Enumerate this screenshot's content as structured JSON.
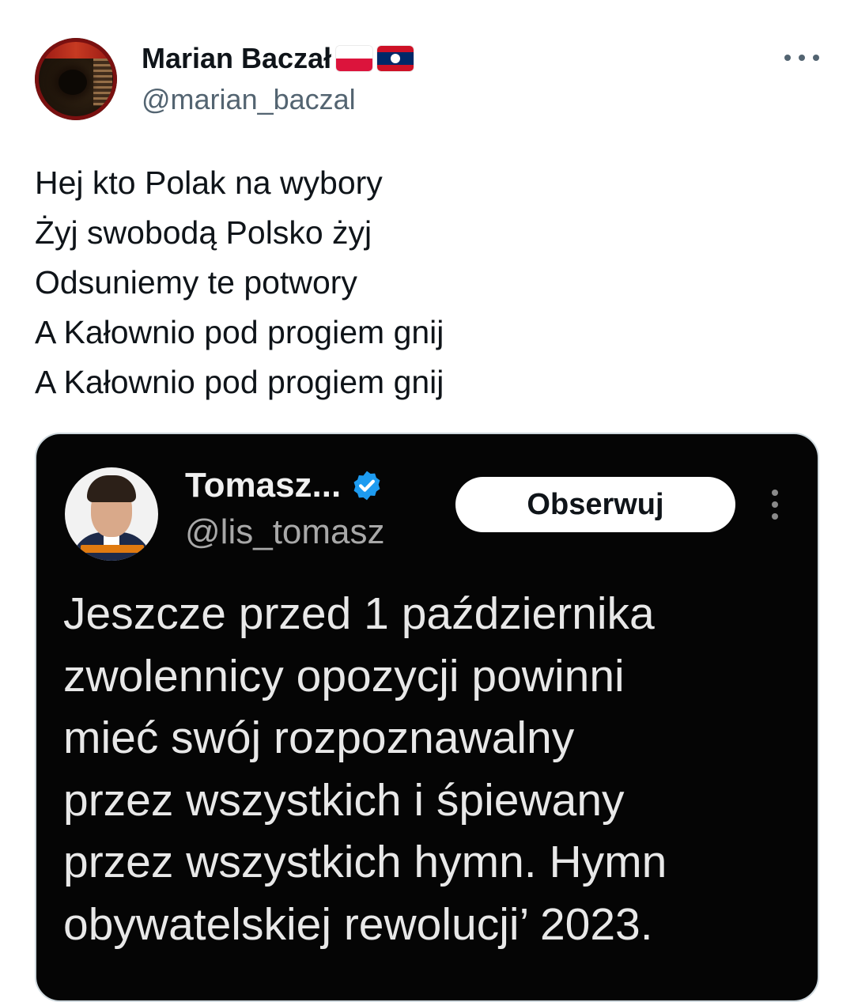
{
  "tweet": {
    "author": {
      "name": "Marian Baczał",
      "handle": "@marian_baczal",
      "flags": [
        "flag-poland-icon",
        "flag-laos-icon"
      ]
    },
    "more_icon": "more-horizontal-icon",
    "text_lines": [
      "Hej kto Polak na wybory",
      "Żyj swobodą Polsko żyj",
      "Odsuniemy te potwory",
      "A Kałownio pod progiem gnij",
      "A Kałownio pod progiem gnij"
    ]
  },
  "embedded_screenshot": {
    "author": {
      "name": "Tomasz...",
      "handle": "@lis_tomasz",
      "verified_icon": "verified-badge-icon"
    },
    "follow_label": "Obserwuj",
    "more_icon": "more-vertical-icon",
    "text_lines": [
      "Jeszcze przed 1 października",
      "zwolennicy opozycji powinni",
      "mieć swój rozpoznawalny",
      "przez wszystkich i śpiewany",
      "przez wszystkich hymn. Hymn",
      "obywatelskiej rewolucji’ 2023."
    ]
  },
  "colors": {
    "text_primary": "#0f1419",
    "text_secondary": "#536471",
    "verified_blue": "#1d9bf0",
    "embedded_background": "#050505",
    "media_border": "#cfd9de"
  }
}
